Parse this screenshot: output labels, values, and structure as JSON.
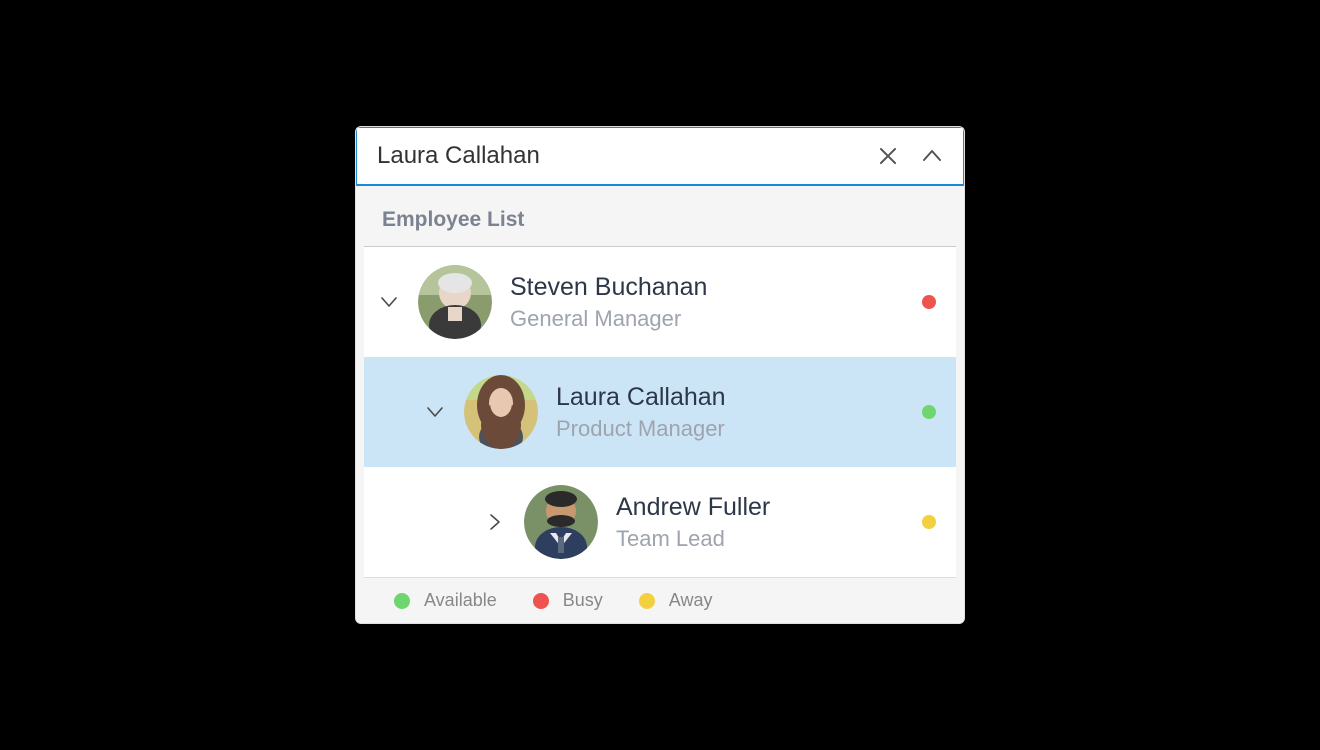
{
  "search": {
    "value": "Laura Callahan"
  },
  "list": {
    "header": "Employee List",
    "items": [
      {
        "name": "Steven Buchanan",
        "role": "General Manager",
        "status": "busy",
        "expanded": true,
        "indent": 0,
        "selected": false,
        "hasChildren": true
      },
      {
        "name": "Laura Callahan",
        "role": "Product Manager",
        "status": "available",
        "expanded": true,
        "indent": 1,
        "selected": true,
        "hasChildren": true
      },
      {
        "name": "Andrew Fuller",
        "role": "Team Lead",
        "status": "away",
        "expanded": false,
        "indent": 2,
        "selected": false,
        "hasChildren": true
      }
    ]
  },
  "legend": [
    {
      "label": "Available",
      "status": "available"
    },
    {
      "label": "Busy",
      "status": "busy"
    },
    {
      "label": "Away",
      "status": "away"
    }
  ]
}
